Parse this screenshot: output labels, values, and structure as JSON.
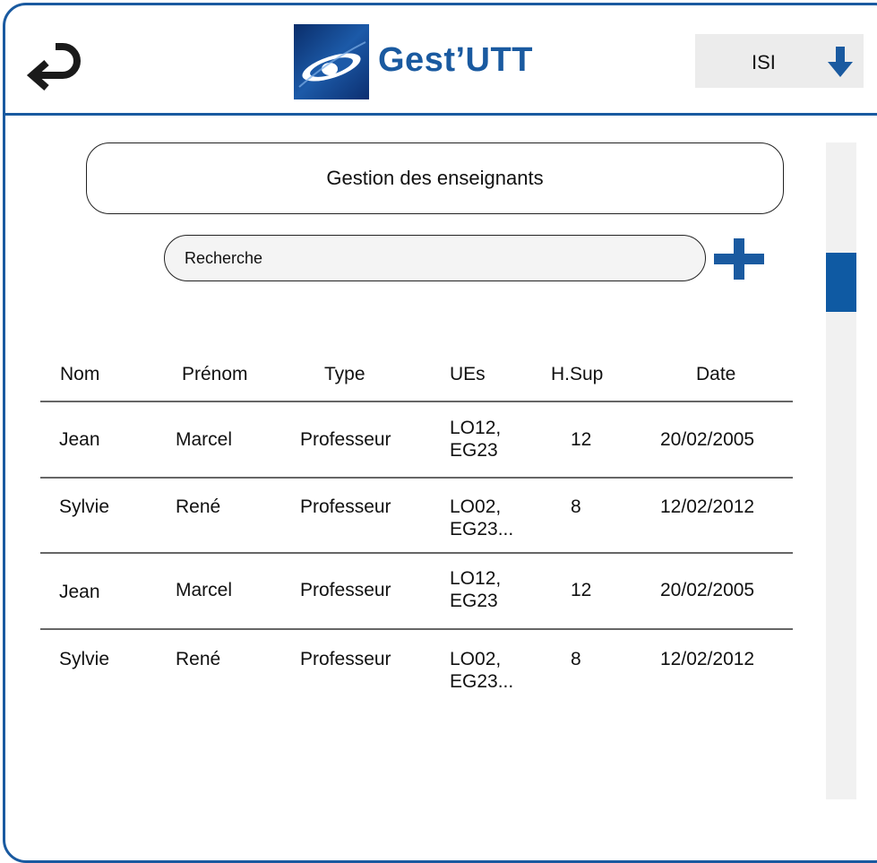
{
  "header": {
    "app_title": "Gest’UTT",
    "department": "ISI"
  },
  "page_title": "Gestion des enseignants",
  "search": {
    "placeholder": "Recherche"
  },
  "table": {
    "columns": [
      "Nom",
      "Prénom",
      "Type",
      "UEs",
      "H.Sup",
      "Date"
    ],
    "rows": [
      {
        "nom": "Jean",
        "prenom": "Marcel",
        "type": "Professeur",
        "ues_line1": "LO12,",
        "ues_line2": "EG23",
        "hsup": "12",
        "date": "20/02/2005"
      },
      {
        "nom": "Sylvie",
        "prenom": "René",
        "type": "Professeur",
        "ues_line1": "LO02,",
        "ues_line2": "EG23...",
        "hsup": "8",
        "date": "12/02/2012"
      },
      {
        "nom": "Jean",
        "prenom": "Marcel",
        "type": "Professeur",
        "ues_line1": "LO12,",
        "ues_line2": "EG23",
        "hsup": "12",
        "date": "20/02/2005"
      },
      {
        "nom": "Sylvie",
        "prenom": "René",
        "type": "Professeur",
        "ues_line1": "LO02,",
        "ues_line2": "EG23...",
        "hsup": "8",
        "date": "12/02/2012"
      }
    ]
  },
  "colors": {
    "accent": "#1a5aa0",
    "scroll_thumb": "#0f5aa3",
    "panel_bg": "#ececec"
  },
  "icons": {
    "back": "return-arrow-icon",
    "dept_toggle": "arrow-down-icon",
    "add": "plus-icon",
    "logo": "utt-logo-icon"
  }
}
